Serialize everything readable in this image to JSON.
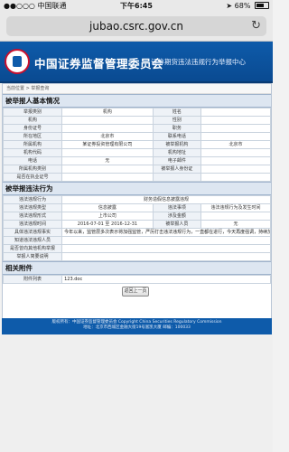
{
  "status_bar": {
    "carrier": "●●○○○ 中国联通",
    "time": "下午6:45",
    "battery": "68%"
  },
  "browser": {
    "url": "jubao.csrc.gov.cn",
    "reload_icon": "reload-icon"
  },
  "site": {
    "title": "中国证券监督管理委员会",
    "subtitle": "证券期货违法违规行为举报中心"
  },
  "breadcrumb": "当前位置 > 举报查询",
  "section_informant": {
    "heading": "被举报人基本情况",
    "rows": [
      [
        "举报类别",
        "机构",
        "姓名",
        ""
      ],
      [
        "机构",
        "",
        "性别",
        ""
      ],
      [
        "身份证号",
        "",
        "职务",
        ""
      ],
      [
        "所在地区",
        "北京市",
        "联系电话",
        ""
      ],
      [
        "所属机构",
        "某证券投资管理有限公司",
        "被举报机构",
        "北京市"
      ],
      [
        "机构代码",
        "",
        "机构地址",
        ""
      ],
      [
        "电话",
        "无",
        "电子邮件",
        ""
      ],
      [
        "所属机构类别",
        "",
        "被举报人身份证",
        ""
      ],
      [
        "是否在执业证号",
        "",
        "",
        ""
      ]
    ]
  },
  "section_violation": {
    "heading": "被举报违法行为",
    "title_label": "违法违规行为",
    "title_value": "财务造假信息披露违规",
    "rows": [
      [
        "违法违规类型",
        "信息披露",
        "违法事项",
        "违法违规行为及发生时间"
      ],
      [
        "违法违规形式",
        "上市公司",
        "涉及金额",
        ""
      ],
      [
        "违法违规时间",
        "2016-07-01 至 2016-12-31",
        "被举报人员",
        "无"
      ]
    ],
    "desc_label": "具体违法违规事实",
    "description": "今年以来，监管层多次表示将加强监管，严厉打击违法违规行为，一直都在进行，今天再度强调，持续加强监管，不断完善制度，加大处罚力度，依法从严查处违法违规行为，维护资本市场秩序，保护投资者合法权益，促进资本市场健康发展。",
    "extra_rows": [
      [
        "知道违法违规人员",
        ""
      ],
      [
        "是否曾向其他机构举报",
        ""
      ],
      [
        "举报人简要说明",
        ""
      ]
    ]
  },
  "section_attachment": {
    "heading": "相关附件",
    "label": "附件列表",
    "file": "123.doc"
  },
  "back_button": "返回上一页",
  "footer": {
    "line1": "版权所有：中国证券监督管理委员会 Copyright China Securities Regulatory Commission",
    "line2": "地址：北京市西城区金融大街19号富凯大厦 邮编：100033"
  }
}
